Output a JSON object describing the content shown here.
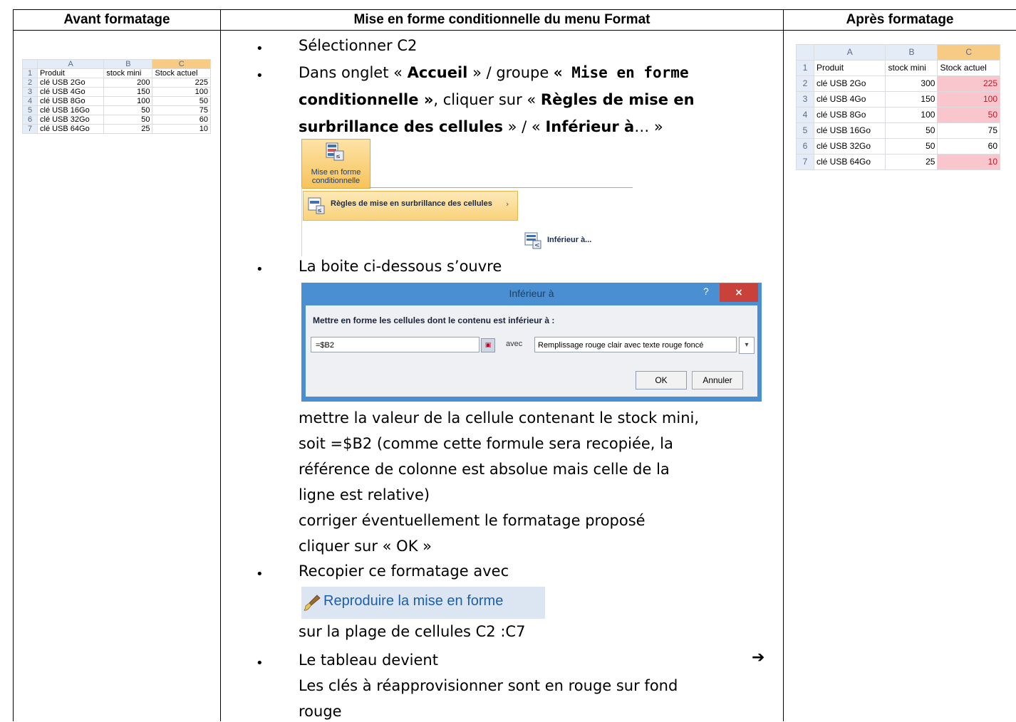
{
  "headers": {
    "col1": "Avant formatage",
    "col2": "Mise en forme conditionnelle du menu Format",
    "col3": "Après formatage"
  },
  "sheet_before": {
    "col_headers": [
      "A",
      "B",
      "C"
    ],
    "rows": [
      {
        "n": "1",
        "a": "Produit",
        "b": "stock mini",
        "c": "Stock actuel"
      },
      {
        "n": "2",
        "a": "clé USB 2Go",
        "b": "200",
        "c": "225"
      },
      {
        "n": "3",
        "a": "clé USB 4Go",
        "b": "150",
        "c": "100"
      },
      {
        "n": "4",
        "a": "clé USB 8Go",
        "b": "100",
        "c": "50"
      },
      {
        "n": "5",
        "a": "clé USB 16Go",
        "b": "50",
        "c": "75"
      },
      {
        "n": "6",
        "a": "clé USB 32Go",
        "b": "50",
        "c": "60"
      },
      {
        "n": "7",
        "a": "clé USB 64Go",
        "b": "25",
        "c": "10"
      }
    ]
  },
  "sheet_after": {
    "col_headers": [
      "A",
      "B",
      "C"
    ],
    "rows": [
      {
        "n": "1",
        "a": "Produit",
        "b": "stock mini",
        "c": "Stock actuel",
        "red": false
      },
      {
        "n": "2",
        "a": "clé USB 2Go",
        "b": "300",
        "c": "225",
        "red": true
      },
      {
        "n": "3",
        "a": "clé USB 4Go",
        "b": "150",
        "c": "100",
        "red": true
      },
      {
        "n": "4",
        "a": "clé USB 8Go",
        "b": "100",
        "c": "50",
        "red": true
      },
      {
        "n": "5",
        "a": "clé USB 16Go",
        "b": "50",
        "c": "75",
        "red": false
      },
      {
        "n": "6",
        "a": "clé USB 32Go",
        "b": "50",
        "c": "60",
        "red": false
      },
      {
        "n": "7",
        "a": "clé USB 64Go",
        "b": "25",
        "c": "10",
        "red": true
      }
    ]
  },
  "steps": {
    "s1": "Sélectionner C2",
    "s2_a": "Dans onglet « ",
    "s2_b": "Accueil",
    "s2_c": " » / groupe ",
    "s2_d": "« Mise en forme",
    "s2_e": "conditionnelle »",
    "s2_f": ", cliquer sur « ",
    "s2_g": "Règles de mise en",
    "s2_h": "surbrillance des cellules",
    "s2_i": " » / « ",
    "s2_j": "Inférieur à",
    "s2_k": "… »",
    "s3": "La boite ci-dessous s’ouvre",
    "s3_l1": "mettre la valeur de la cellule contenant le stock mini,",
    "s3_l2": "soit =$B2 (comme cette formule sera recopiée, la",
    "s3_l3": "référence de colonne est absolue mais celle de la",
    "s3_l4": "ligne est relative)",
    "s3_l5": "corriger éventuellement le formatage proposé",
    "s3_l6": "cliquer sur « OK »",
    "s4": "Recopier ce formatage avec",
    "s4_after": "sur la plage de cellules C2 :C7",
    "s5": "Le tableau devient",
    "s5_l1": "Les clés à réapprovisionner sont en rouge sur fond",
    "s5_l2": "rouge"
  },
  "ribbon": {
    "button_label": "Mise en forme conditionnelle",
    "menu_item": "Règles de mise en surbrillance des cellules",
    "menu_arrow": "›",
    "submenu_item": "Inférieur à..."
  },
  "dialog": {
    "title": "Inférieur à",
    "help": "?",
    "close": "×",
    "prompt": "Mettre en forme les cellules dont le contenu est inférieur à :",
    "input_value": "=$B2",
    "avec": "avec",
    "format_value": "Remplissage rouge clair avec texte rouge foncé",
    "ok": "OK",
    "cancel": "Annuler"
  },
  "painter": {
    "label": "Reproduire la mise en forme"
  },
  "arrow": "➔"
}
